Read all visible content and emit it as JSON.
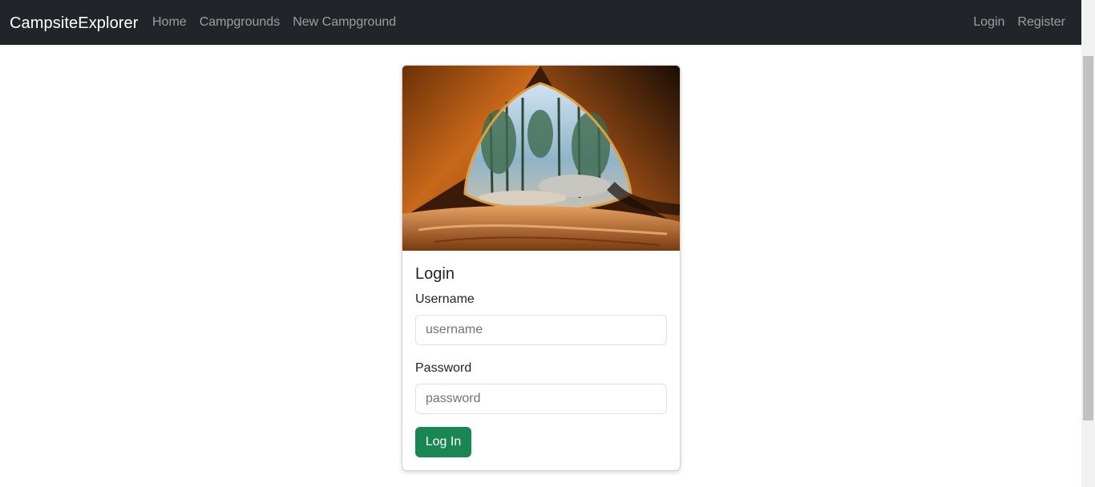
{
  "navbar": {
    "brand": "CampsiteExplorer",
    "links": [
      "Home",
      "Campgrounds",
      "New Campground"
    ],
    "right_links": [
      "Login",
      "Register"
    ]
  },
  "login_card": {
    "title": "Login",
    "username_label": "Username",
    "username_placeholder": "username",
    "password_label": "Password",
    "password_placeholder": "password",
    "submit_label": "Log In",
    "image_alt": "View from inside an orange tent looking out at a forest"
  },
  "colors": {
    "navbar_bg": "#212529",
    "primary_button": "#198754",
    "nav_link": "rgba(255,255,255,0.55)"
  }
}
